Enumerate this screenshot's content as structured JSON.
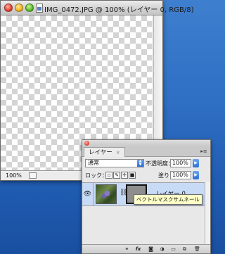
{
  "document_window": {
    "title": "IMG_0472.JPG @ 100% (レイヤー 0, RGB/8)",
    "zoom_level": "100%"
  },
  "layers_panel": {
    "tab_label": "レイヤー",
    "tab_close": "×",
    "blend_mode": "通常",
    "opacity_label": "不透明度：",
    "opacity_value": "100%",
    "lock_label": "ロック：",
    "fill_label": "塗り：",
    "fill_value": "100%",
    "layer": {
      "name": "レイヤー 0"
    },
    "tooltip": "ベクトルマスクサムネール",
    "bottom_icons": [
      "link-icon",
      "fx-icon",
      "mask-icon",
      "adjustment-icon",
      "folder-icon",
      "new-layer-icon",
      "trash-icon"
    ]
  }
}
